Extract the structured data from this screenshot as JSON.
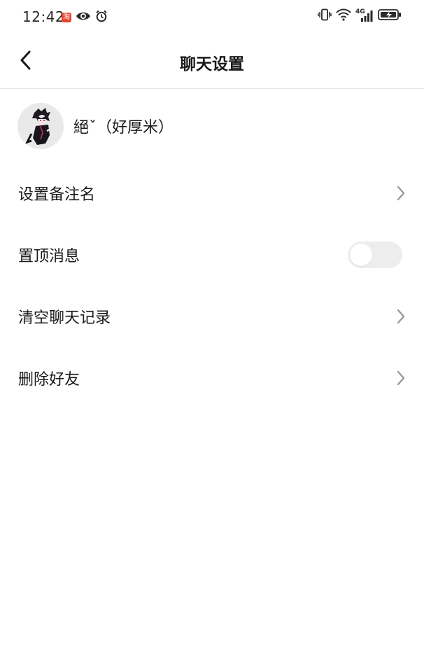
{
  "status_bar": {
    "time": "12:42",
    "left_icons": [
      "taobao-icon",
      "eye-icon",
      "alarm-icon"
    ],
    "right_icons": [
      "vibrate-icon",
      "wifi-icon",
      "signal-4g-icon",
      "battery-charging-icon"
    ],
    "taobao_badge": "淘",
    "network_label": "4G"
  },
  "header": {
    "title": "聊天设置",
    "back_icon": "chevron-left-icon"
  },
  "profile": {
    "name": "絕ˇ（好厚米）",
    "avatar": "avatar-image"
  },
  "settings": {
    "remark": {
      "label": "设置备注名",
      "icon": "chevron-right-icon"
    },
    "pin": {
      "label": "置顶消息",
      "toggle_on": false
    },
    "clear_history": {
      "label": "清空聊天记录",
      "icon": "chevron-right-icon"
    },
    "delete_friend": {
      "label": "删除好友",
      "icon": "chevron-right-icon"
    }
  },
  "colors": {
    "background": "#ffffff",
    "text": "#1a1a1a",
    "chevron": "#9a9a9a",
    "toggle_off": "#ededed",
    "divider": "#e6e6e6",
    "taobao_badge": "#e8452c"
  }
}
